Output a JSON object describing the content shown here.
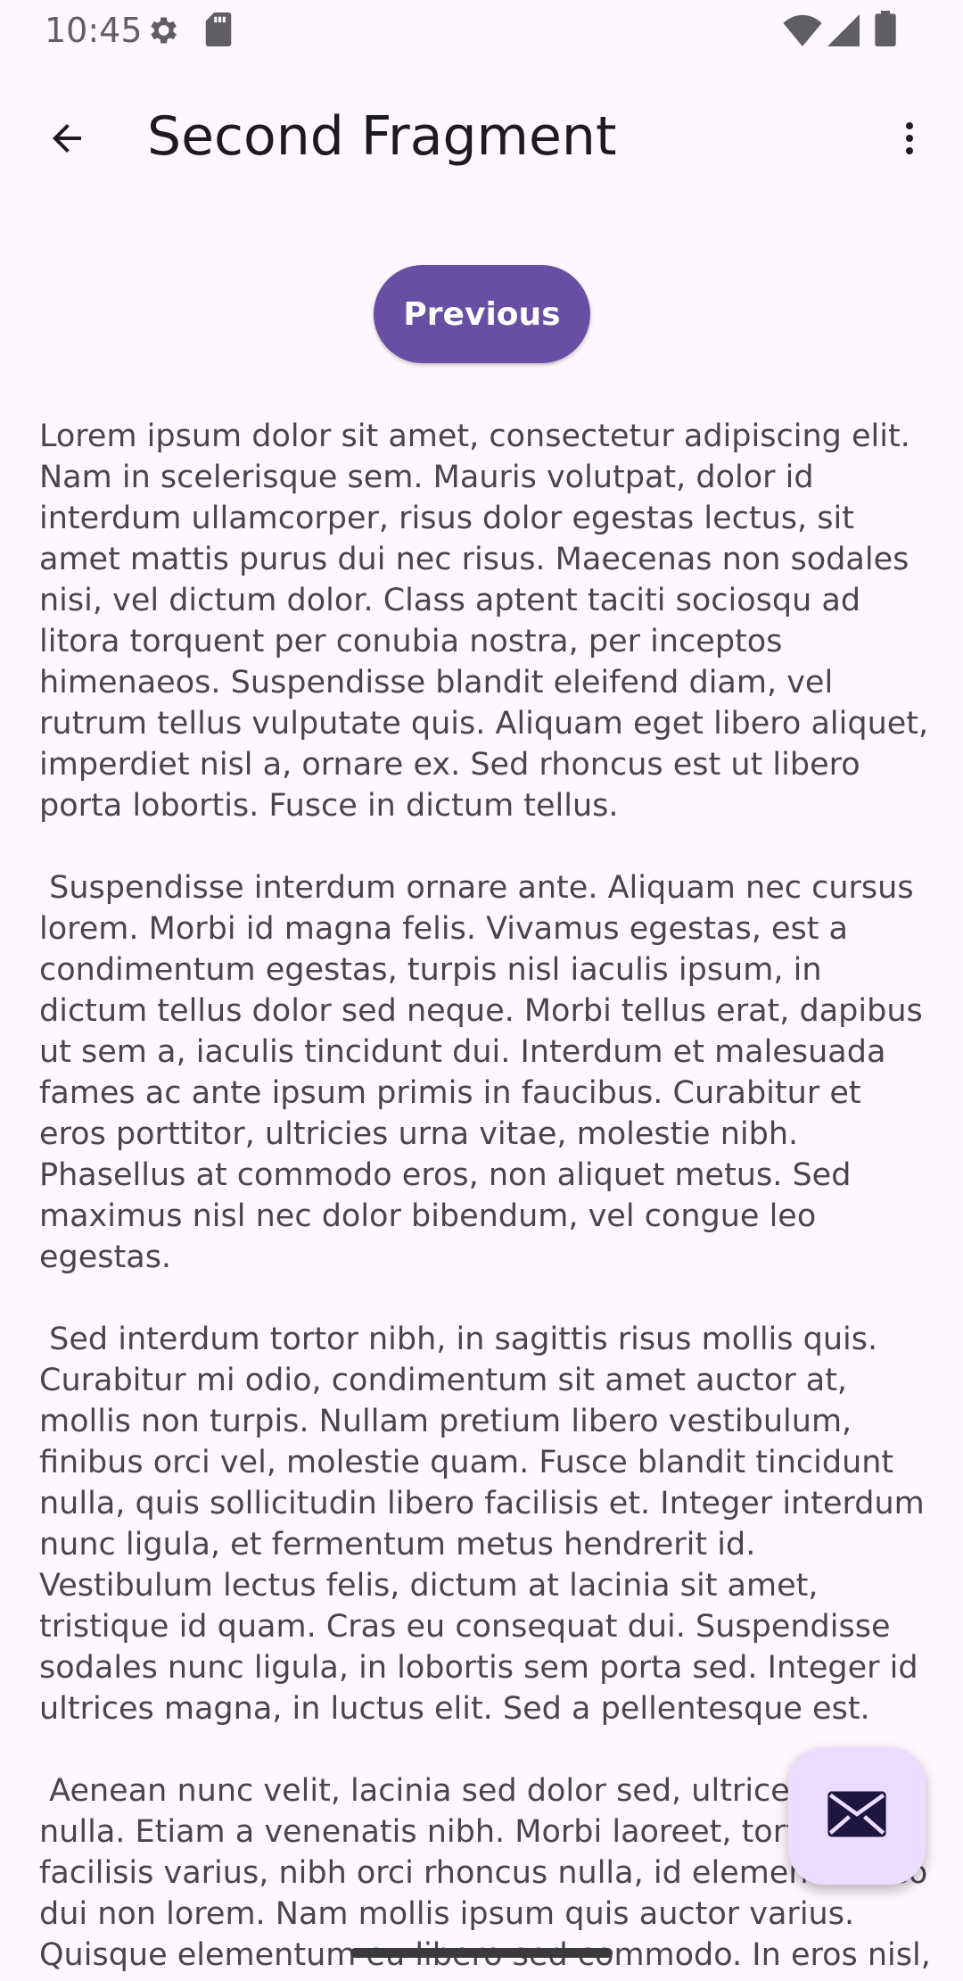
{
  "status_bar": {
    "time": "10:45",
    "icons": [
      "settings-gear-icon",
      "sd-card-icon",
      "wifi-icon",
      "cell-signal-icon",
      "battery-icon"
    ]
  },
  "app_bar": {
    "title": "Second Fragment",
    "back_icon": "arrow-back-icon",
    "overflow_icon": "more-vert-icon"
  },
  "actions": {
    "previous_label": "Previous"
  },
  "content": {
    "text": "Lorem ipsum dolor sit amet, consectetur adipiscing elit. Nam in scelerisque sem. Mauris volutpat, dolor id interdum ullamcorper, risus dolor egestas lectus, sit amet mattis purus dui nec risus. Maecenas non sodales nisi, vel dictum dolor. Class aptent taciti sociosqu ad litora torquent per conubia nostra, per inceptos himenaeos. Suspendisse blandit eleifend diam, vel rutrum tellus vulputate quis. Aliquam eget libero aliquet, imperdiet nisl a, ornare ex. Sed rhoncus est ut libero porta lobortis. Fusce in dictum tellus.\n\n Suspendisse interdum ornare ante. Aliquam nec cursus lorem. Morbi id magna felis. Vivamus egestas, est a condimentum egestas, turpis nisl iaculis ipsum, in dictum tellus dolor sed neque. Morbi tellus erat, dapibus ut sem a, iaculis tincidunt dui. Interdum et malesuada fames ac ante ipsum primis in faucibus. Curabitur et eros porttitor, ultricies urna vitae, molestie nibh. Phasellus at commodo eros, non aliquet metus. Sed maximus nisl nec dolor bibendum, vel congue leo egestas.\n\n Sed interdum tortor nibh, in sagittis risus mollis quis. Curabitur mi odio, condimentum sit amet auctor at, mollis non turpis. Nullam pretium libero vestibulum, finibus orci vel, molestie quam. Fusce blandit tincidunt nulla, quis sollicitudin libero facilisis et. Integer interdum nunc ligula, et fermentum metus hendrerit id. Vestibulum lectus felis, dictum at lacinia sit amet, tristique id quam. Cras eu consequat dui. Suspendisse sodales nunc ligula, in lobortis sem porta sed. Integer id ultrices magna, in luctus elit. Sed a pellentesque est.\n\n Aenean nunc velit, lacinia sed dolor sed, ultrices viverra nulla. Etiam a venenatis nibh. Morbi laoreet, tortor sed facilisis varius, nibh orci rhoncus nulla, id elementum leo dui non lorem. Nam mollis ipsum quis auctor varius. Quisque elementum eu libero sed commodo. In eros nisl, imperdiet vel imperdiet et, scelerisque a mauris."
  },
  "fab": {
    "icon": "email-icon"
  },
  "colors": {
    "primary": "#6750a4",
    "fab_container": "#eaddff",
    "background": "#fdf8fd",
    "body_text": "#49454f"
  }
}
